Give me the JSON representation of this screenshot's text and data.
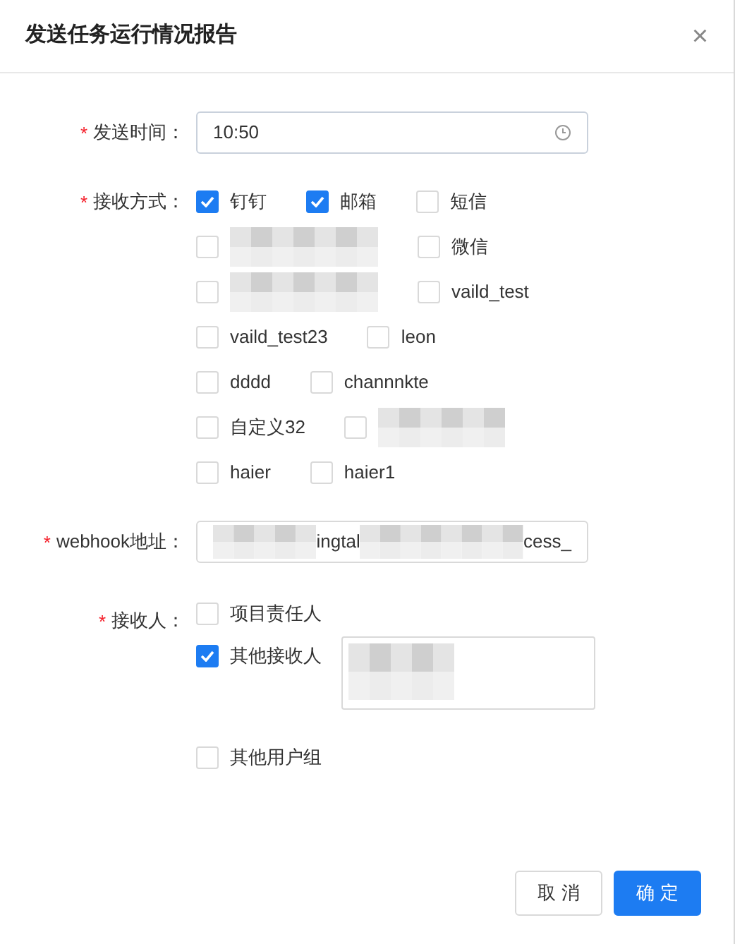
{
  "dialog": {
    "title": "发送任务运行情况报告",
    "close": "×"
  },
  "send_time": {
    "required_mark": "*",
    "label": "发送时间：",
    "value": "10:50"
  },
  "channels": {
    "required_mark": "*",
    "label": "接收方式：",
    "rows": [
      [
        {
          "kind": "option",
          "label": "钉钉",
          "checked": true
        },
        {
          "kind": "option",
          "label": "邮箱",
          "checked": true
        },
        {
          "kind": "option",
          "label": "短信",
          "checked": false
        }
      ],
      [
        {
          "kind": "blurred",
          "checked": false
        },
        {
          "kind": "option",
          "label": "微信",
          "checked": false
        }
      ],
      [
        {
          "kind": "blurred",
          "checked": false
        },
        {
          "kind": "option",
          "label": "vaild_test",
          "checked": false
        }
      ],
      [
        {
          "kind": "option",
          "label": "vaild_test23",
          "checked": false
        },
        {
          "kind": "option",
          "label": "leon",
          "checked": false
        }
      ],
      [
        {
          "kind": "option",
          "label": "dddd",
          "checked": false
        },
        {
          "kind": "option",
          "label": "channnkte",
          "checked": false
        }
      ],
      [
        {
          "kind": "option",
          "label": "自定义32",
          "checked": false
        },
        {
          "kind": "blurred",
          "checked": false
        }
      ],
      [
        {
          "kind": "option",
          "label": "haier",
          "checked": false
        },
        {
          "kind": "option",
          "label": "haier1",
          "checked": false
        }
      ]
    ]
  },
  "webhook": {
    "required_mark": "*",
    "label": "webhook地址：",
    "visible_parts": [
      "ingtal",
      "cess_"
    ]
  },
  "recipients": {
    "required_mark": "*",
    "label": "接收人：",
    "options": [
      {
        "kind": "plain",
        "label": "项目责任人",
        "checked": false
      },
      {
        "kind": "with_tags",
        "label": "其他接收人",
        "checked": true
      },
      {
        "kind": "plain",
        "label": "其他用户组",
        "checked": false
      }
    ]
  },
  "buttons": [
    {
      "label": "取 消",
      "kind": "default"
    },
    {
      "label": "确 定",
      "kind": "primary"
    }
  ]
}
